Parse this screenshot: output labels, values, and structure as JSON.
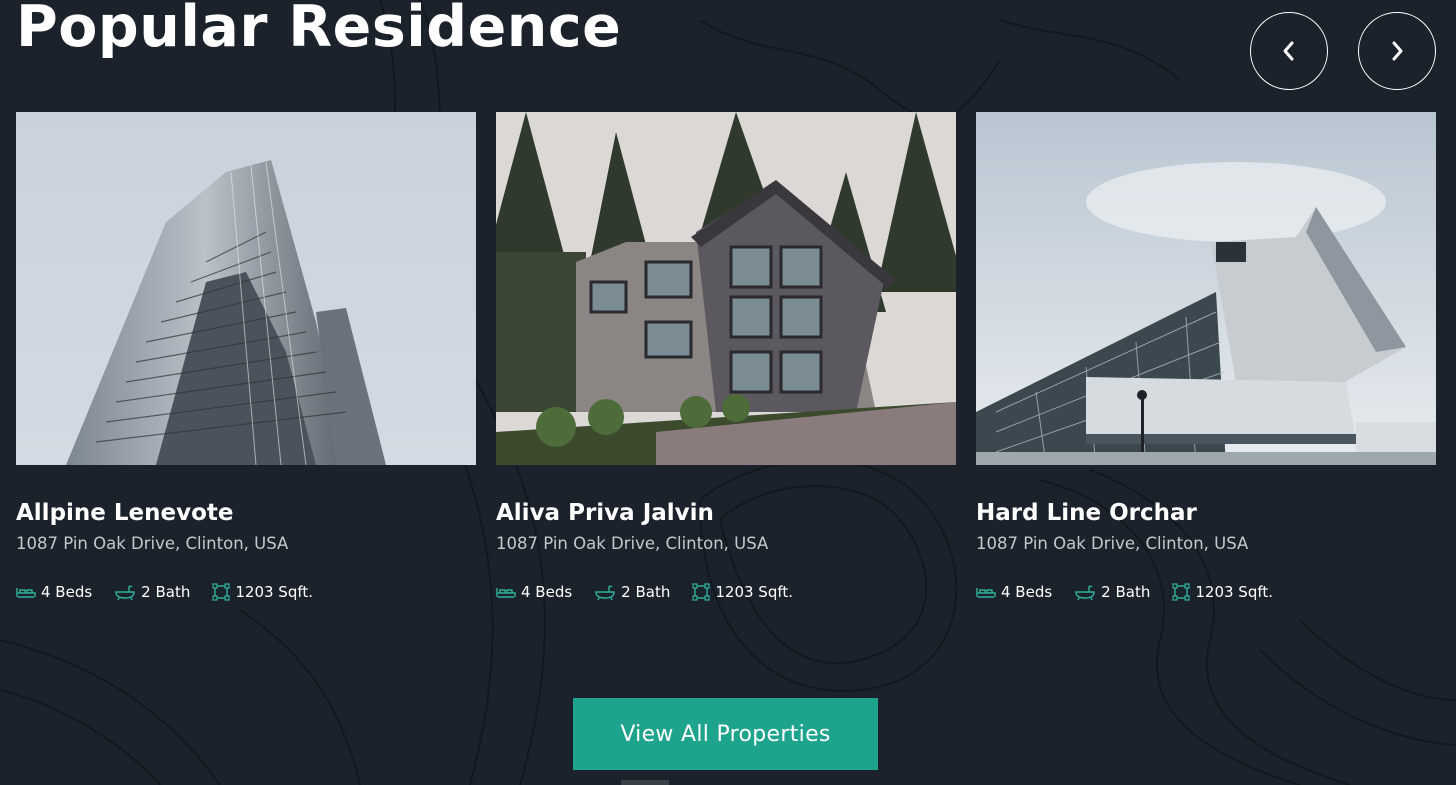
{
  "section": {
    "title": "Popular Residence"
  },
  "nav": {
    "prev_icon": "chevron-left-icon",
    "next_icon": "chevron-right-icon"
  },
  "colors": {
    "background": "#1b222b",
    "accent": "#1ea38d",
    "icon_accent": "#2fb39a",
    "text_muted": "#c4c9cf"
  },
  "properties": [
    {
      "name": "Allpine Lenevote",
      "address": "1087 Pin Oak Drive, Clinton, USA",
      "beds": "4 Beds",
      "bath": "2 Bath",
      "area": "1203 Sqft.",
      "image": "skyscraper-photo"
    },
    {
      "name": "Aliva Priva Jalvin",
      "address": "1087 Pin Oak Drive, Clinton, USA",
      "beds": "4 Beds",
      "bath": "2 Bath",
      "area": "1203 Sqft.",
      "image": "mountain-house-photo"
    },
    {
      "name": "Hard Line Orchar",
      "address": "1087 Pin Oak Drive, Clinton, USA",
      "beds": "4 Beds",
      "bath": "2 Bath",
      "area": "1203 Sqft.",
      "image": "modern-building-photo"
    }
  ],
  "cta": {
    "label": "View All Properties"
  }
}
